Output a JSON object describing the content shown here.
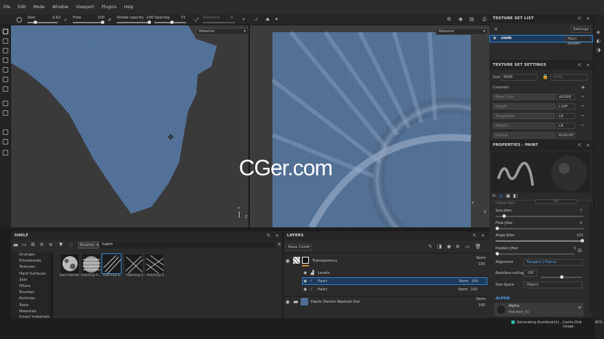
{
  "menu": [
    "File",
    "Edit",
    "Mode",
    "Window",
    "Viewport",
    "Plugins",
    "Help"
  ],
  "toolbar": {
    "size_label": "Size",
    "size_value": "2.62",
    "flow_label": "Flow",
    "flow_value": "100",
    "stroke_label": "Stroke opacity",
    "stroke_value": "100",
    "spacing_label": "Spacing",
    "spacing_value": "73",
    "distance_label": "Distance",
    "distance_value": "6"
  },
  "viewport": {
    "left_mode": "Material",
    "right_mode": "Material",
    "axis_y": "Y",
    "axis_z": "Z",
    "axis_y2": "Y",
    "axis_x2": "X",
    "watermark": "CGer.com"
  },
  "texture_set_list": {
    "title": "TEXTURE SET LIST",
    "settings_btn": "Settings",
    "item_name": "cloth",
    "item_shader": "Main shader"
  },
  "texture_set_settings": {
    "title": "TEXTURE SET SETTINGS",
    "size_label": "Size",
    "size_value": "4096",
    "size_value2": "4096",
    "channels_label": "Channels",
    "channels": [
      {
        "name": "Base Color",
        "format": "sRGB8"
      },
      {
        "name": "Height",
        "format": "L16F"
      },
      {
        "name": "Roughness",
        "format": "L8"
      },
      {
        "name": "Metallic",
        "format": "L8"
      },
      {
        "name": "Normal",
        "format": "RGB16F"
      }
    ]
  },
  "properties": {
    "title": "PROPERTIES - PAINT",
    "follow_path": "Follow Path",
    "follow_path_value": "Off",
    "size_jitter": "Size Jitter",
    "size_jitter_value": "7",
    "flow_jitter": "Flow Jitter",
    "flow_jitter_value": "0",
    "angle_jitter": "Angle Jitter",
    "angle_jitter_value": "100",
    "position_jitter": "Position Jitter",
    "position_jitter_value": "0",
    "alignment": "Alignment",
    "alignment_value": "Tangent | Planar",
    "backface": "Backface culling",
    "backface_value": "Off",
    "size_space": "Size Space",
    "size_space_value": "Object",
    "alpha_title": "ALPHA",
    "alpha_name": "Alpha",
    "alpha_sub": "Hatched_01"
  },
  "shelf": {
    "title": "SHELF",
    "filter_tag": "Brushes",
    "search": "hatch",
    "categories": [
      "Grunges",
      "Procedurals",
      "Textures",
      "Hard Surfaces",
      "Skin",
      "Filters",
      "Brushes",
      "Particles",
      "Tools",
      "Materials",
      "Smart materials"
    ],
    "brushes": [
      "Dart Hatcher",
      "Hatching G...",
      "Hatching B...",
      "Hatching S...",
      "Hatching S..."
    ]
  },
  "layers": {
    "title": "LAYERS",
    "channel": "Base Color",
    "rows": [
      {
        "name": "Transparency",
        "blend": "Norm",
        "opacity": "100"
      },
      {
        "name": "Levels",
        "blend": "",
        "opacity": ""
      },
      {
        "name": "Paint",
        "blend": "Norm",
        "opacity": "100"
      },
      {
        "name": "Paint",
        "blend": "Norm",
        "opacity": "100"
      },
      {
        "name": "Fabric Denim Washed Out",
        "blend": "Norm",
        "opacity": "100"
      }
    ]
  },
  "status": {
    "thumbs": "Generating thumbnail(s) ...",
    "cache": "Cache Disk Usage:",
    "cache_value": "82%"
  },
  "colors": {
    "accent": "#2f8ae0",
    "cloth": "#4f6e95",
    "selected": "#1e3a5c"
  }
}
